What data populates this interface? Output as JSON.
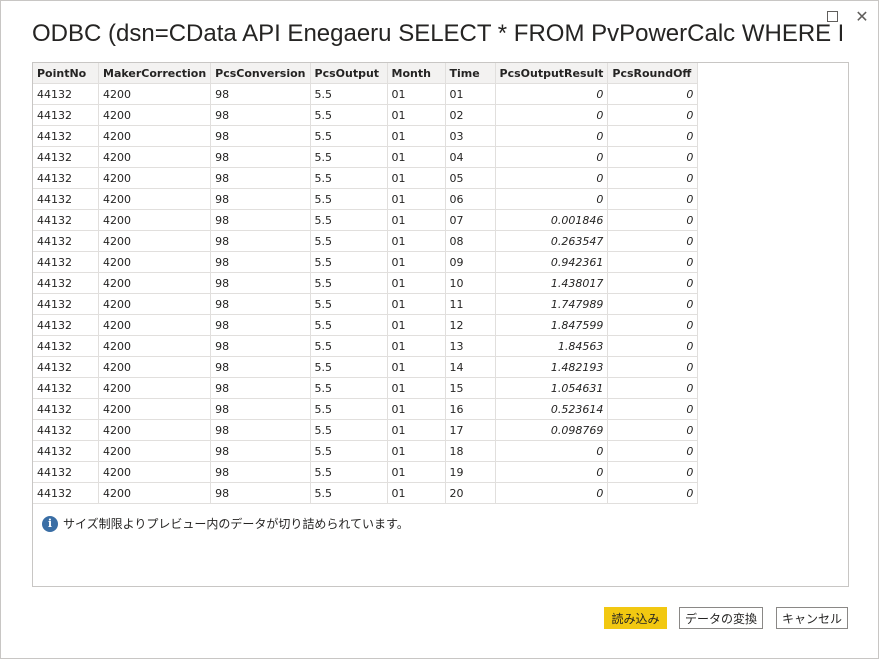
{
  "window": {
    "title": "ODBC (dsn=CData API Enegaeru SELECT * FROM PvPowerCalc WHERE PointN...",
    "maximize_glyph": "",
    "close_glyph": "✕"
  },
  "table": {
    "columns": [
      "PointNo",
      "MakerCorrection",
      "PcsConversion",
      "PcsOutput",
      "Month",
      "Time",
      "PcsOutputResult",
      "PcsRoundOff"
    ],
    "rows": [
      [
        "44132",
        "4200",
        "98",
        "5.5",
        "01",
        "01",
        "0",
        "0"
      ],
      [
        "44132",
        "4200",
        "98",
        "5.5",
        "01",
        "02",
        "0",
        "0"
      ],
      [
        "44132",
        "4200",
        "98",
        "5.5",
        "01",
        "03",
        "0",
        "0"
      ],
      [
        "44132",
        "4200",
        "98",
        "5.5",
        "01",
        "04",
        "0",
        "0"
      ],
      [
        "44132",
        "4200",
        "98",
        "5.5",
        "01",
        "05",
        "0",
        "0"
      ],
      [
        "44132",
        "4200",
        "98",
        "5.5",
        "01",
        "06",
        "0",
        "0"
      ],
      [
        "44132",
        "4200",
        "98",
        "5.5",
        "01",
        "07",
        "0.001846",
        "0"
      ],
      [
        "44132",
        "4200",
        "98",
        "5.5",
        "01",
        "08",
        "0.263547",
        "0"
      ],
      [
        "44132",
        "4200",
        "98",
        "5.5",
        "01",
        "09",
        "0.942361",
        "0"
      ],
      [
        "44132",
        "4200",
        "98",
        "5.5",
        "01",
        "10",
        "1.438017",
        "0"
      ],
      [
        "44132",
        "4200",
        "98",
        "5.5",
        "01",
        "11",
        "1.747989",
        "0"
      ],
      [
        "44132",
        "4200",
        "98",
        "5.5",
        "01",
        "12",
        "1.847599",
        "0"
      ],
      [
        "44132",
        "4200",
        "98",
        "5.5",
        "01",
        "13",
        "1.84563",
        "0"
      ],
      [
        "44132",
        "4200",
        "98",
        "5.5",
        "01",
        "14",
        "1.482193",
        "0"
      ],
      [
        "44132",
        "4200",
        "98",
        "5.5",
        "01",
        "15",
        "1.054631",
        "0"
      ],
      [
        "44132",
        "4200",
        "98",
        "5.5",
        "01",
        "16",
        "0.523614",
        "0"
      ],
      [
        "44132",
        "4200",
        "98",
        "5.5",
        "01",
        "17",
        "0.098769",
        "0"
      ],
      [
        "44132",
        "4200",
        "98",
        "5.5",
        "01",
        "18",
        "0",
        "0"
      ],
      [
        "44132",
        "4200",
        "98",
        "5.5",
        "01",
        "19",
        "0",
        "0"
      ],
      [
        "44132",
        "4200",
        "98",
        "5.5",
        "01",
        "20",
        "0",
        "0"
      ]
    ]
  },
  "notice": {
    "icon": "info-icon",
    "icon_glyph": "i",
    "text": "サイズ制限よりプレビュー内のデータが切り詰められています。"
  },
  "buttons": {
    "load": "読み込み",
    "transform": "データの変換",
    "cancel": "キャンセル"
  },
  "colors": {
    "primary_button": "#f2c811",
    "info_icon": "#3a6ea5"
  }
}
